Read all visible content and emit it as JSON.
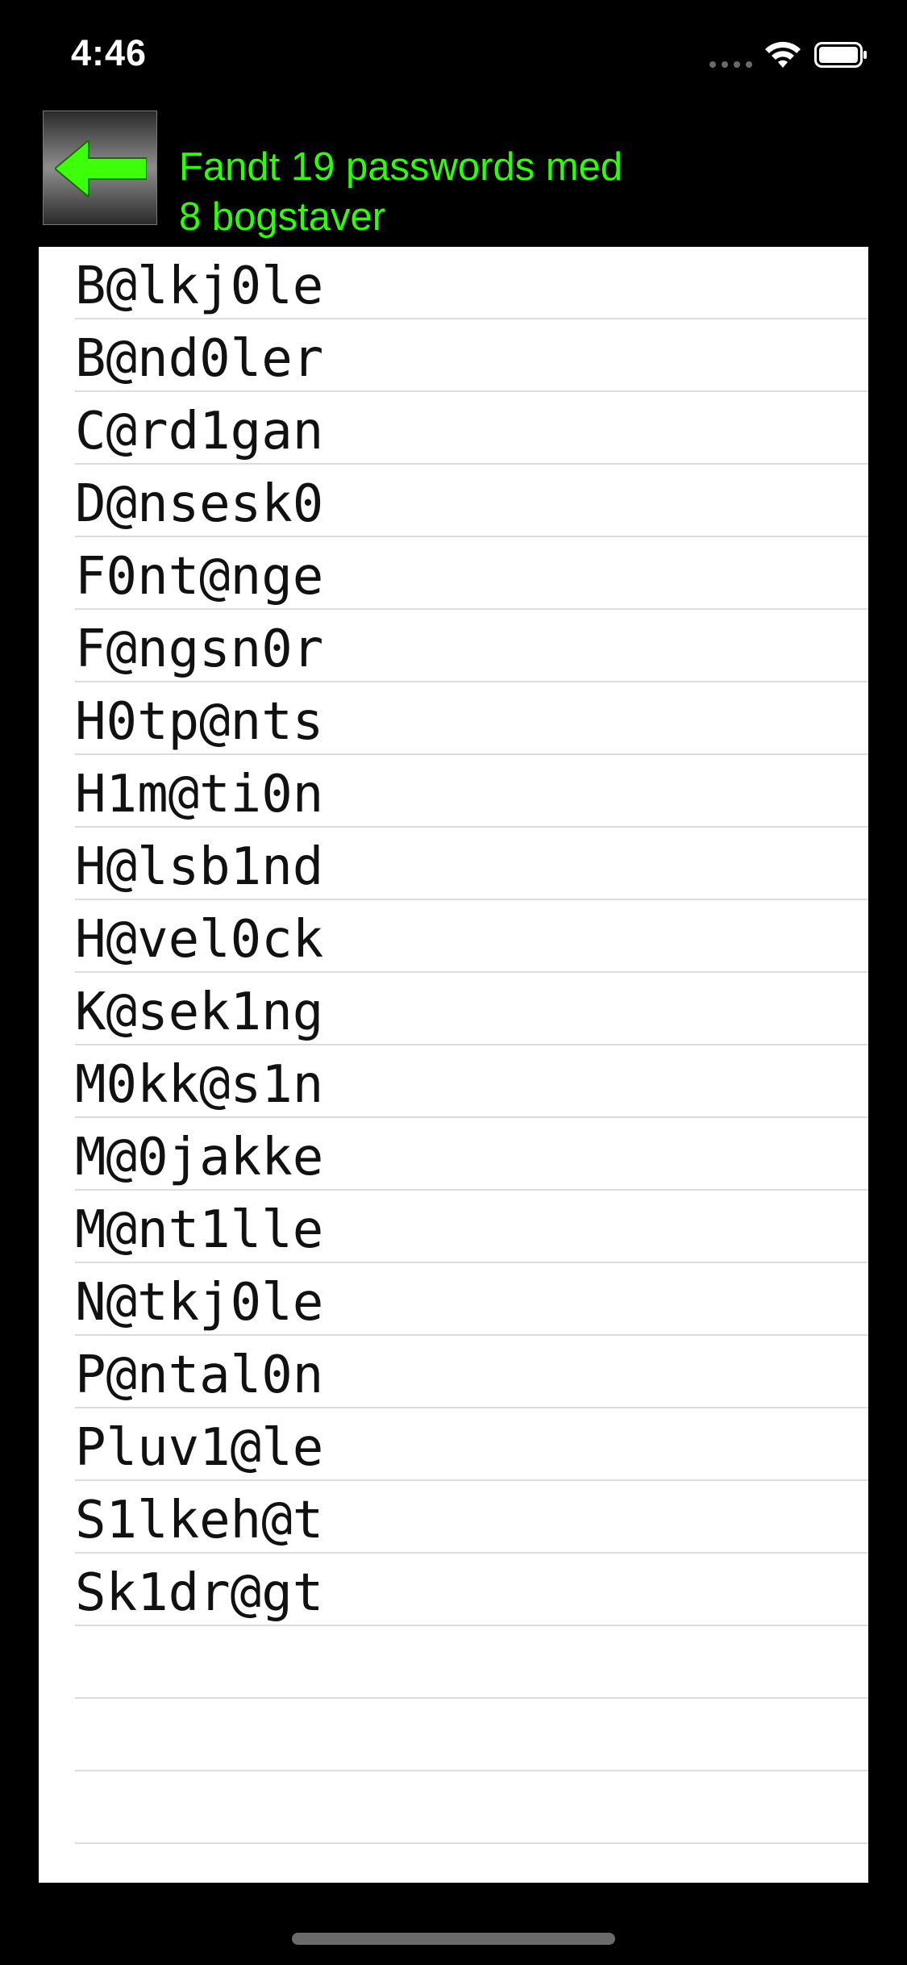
{
  "status_bar": {
    "time": "4:46"
  },
  "header": {
    "back_icon": "left-arrow-icon",
    "title_line1": "Fandt 19 passwords med",
    "title_line2": "8 bogstaver",
    "accent_color": "#2bff00"
  },
  "passwords": [
    "B@lkj0le",
    "B@nd0ler",
    "C@rd1gan",
    "D@nsesk0",
    "F0nt@nge",
    "F@ngsn0r",
    "H0tp@nts",
    "H1m@ti0n",
    "H@lsb1nd",
    "H@vel0ck",
    "K@sek1ng",
    "M0kk@s1n",
    "M@0jakke",
    "M@nt1lle",
    "N@tkj0le",
    "P@ntal0n",
    "Pluv1@le",
    "S1lkeh@t",
    "Sk1dr@gt",
    "",
    "",
    "",
    ""
  ]
}
